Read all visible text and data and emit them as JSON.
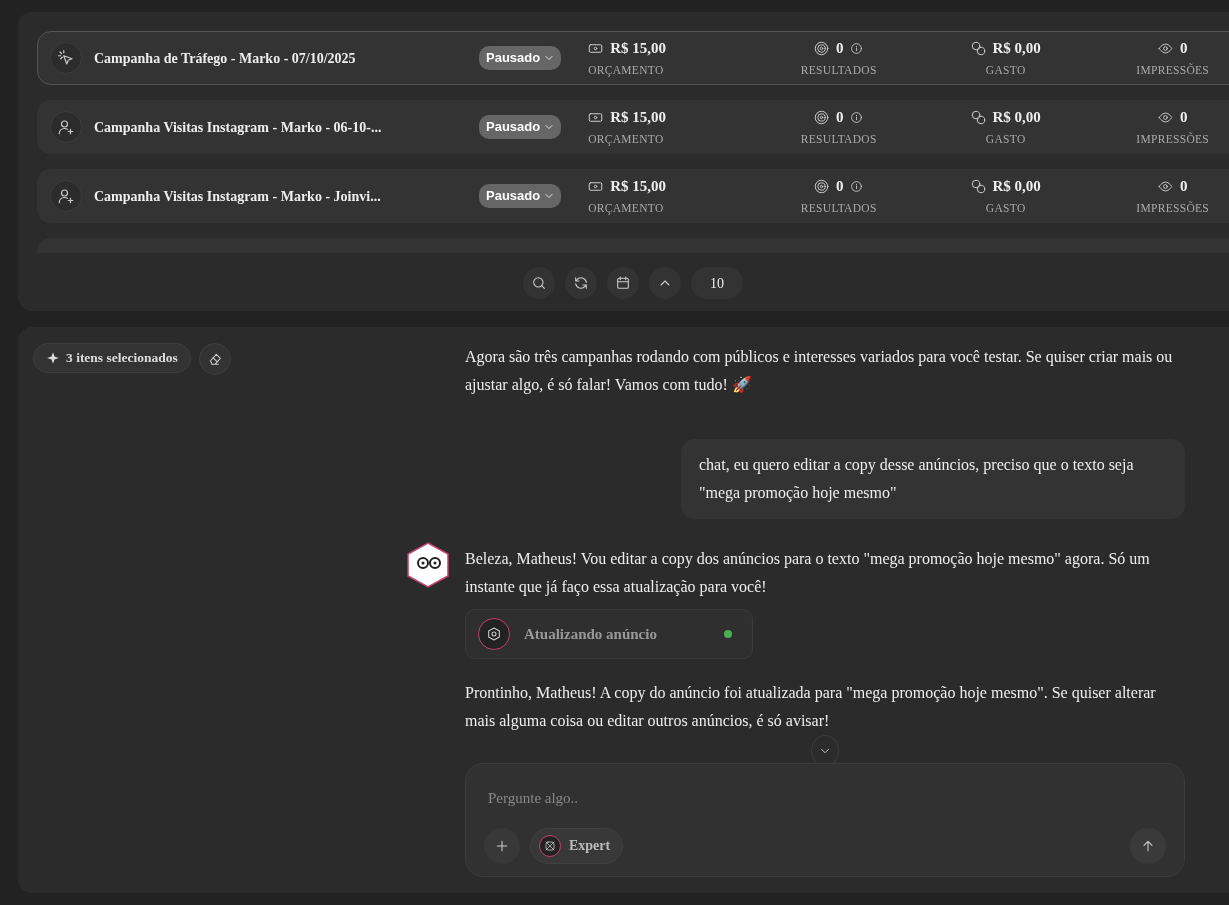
{
  "campaigns": [
    {
      "kind": "traffic",
      "title": "Campanha de Tráfego - Marko - 07/10/2025",
      "selected": true,
      "status": "Pausado",
      "metrics": [
        {
          "kind": "budget",
          "value": "R$ 15,00",
          "label": "ORÇAMENTO",
          "info": false
        },
        {
          "kind": "results",
          "value": "0",
          "label": "RESULTADOS",
          "info": true
        },
        {
          "kind": "spent",
          "value": "R$ 0,00",
          "label": "GASTO",
          "info": false
        },
        {
          "kind": "impressions",
          "value": "0",
          "label": "IMPRESSÕES",
          "info": false
        }
      ]
    },
    {
      "kind": "visits",
      "title": "Campanha Visitas Instagram - Marko - 06-10-...",
      "selected": false,
      "status": "Pausado",
      "metrics": [
        {
          "kind": "budget",
          "value": "R$ 15,00",
          "label": "ORÇAMENTO",
          "info": false
        },
        {
          "kind": "results",
          "value": "0",
          "label": "RESULTADOS",
          "info": true
        },
        {
          "kind": "spent",
          "value": "R$ 0,00",
          "label": "GASTO",
          "info": false
        },
        {
          "kind": "impressions",
          "value": "0",
          "label": "IMPRESSÕES",
          "info": false
        }
      ]
    },
    {
      "kind": "visits",
      "title": "Campanha Visitas Instagram - Marko - Joinvi...",
      "selected": false,
      "status": "Pausado",
      "metrics": [
        {
          "kind": "budget",
          "value": "R$ 15,00",
          "label": "ORÇAMENTO",
          "info": false
        },
        {
          "kind": "results",
          "value": "0",
          "label": "RESULTADOS",
          "info": true
        },
        {
          "kind": "spent",
          "value": "R$ 0,00",
          "label": "GASTO",
          "info": false
        },
        {
          "kind": "impressions",
          "value": "0",
          "label": "IMPRESSÕES",
          "info": false
        }
      ]
    }
  ],
  "toolbar": {
    "page_size": "10"
  },
  "selection": {
    "label": "3 itens selecionados"
  },
  "messages": [
    {
      "kind": "assistant",
      "avatar": false,
      "text": "Agora são três campanhas rodando com públicos e interesses variados para você testar. Se quiser criar mais ou ajustar algo, é só falar! Vamos com tudo! 🚀"
    },
    {
      "kind": "user",
      "text": "chat, eu quero editar a copy desse anúncios, preciso que o texto seja \"mega promoção hoje mesmo\""
    },
    {
      "kind": "assistant",
      "avatar": true,
      "text": "Beleza, Matheus! Vou editar a copy dos anúncios para o texto \"mega promoção hoje mesmo\" agora. Só um instante que já faço essa atualização para você!"
    },
    {
      "kind": "tool",
      "text": "Atualizando anúncio",
      "color": "#4caf50"
    },
    {
      "kind": "assistant",
      "avatar": false,
      "text": "Prontinho, Matheus! A copy do anúncio foi atualizada para \"mega promoção hoje mesmo\". Se quiser alterar mais alguma coisa ou editar outros anúncios, é só avisar!"
    }
  ],
  "composer": {
    "placeholder": "Pergunte algo..",
    "mode": "Expert"
  }
}
